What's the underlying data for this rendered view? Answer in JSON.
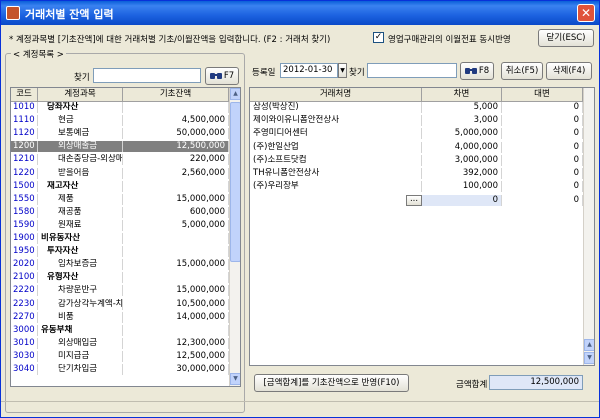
{
  "window": {
    "title": "거래처별 잔액 입력",
    "close": "✕"
  },
  "info": "* 계정과목별 [기초잔액]에 대한 거래처별 기초/이월잔액을 입력합니다. (F2 : 거래처 찾기)",
  "sync": {
    "label": "영업구매관리의 이월전표 동시반영",
    "checked": "✓"
  },
  "buttons": {
    "close": "닫기(ESC)",
    "find_left": "F7",
    "find_right": "F8",
    "cancel": "취소(F5)",
    "delete": "삭제(F4)",
    "apply": "[금액합계]를 기초잔액으로 반영(F10)"
  },
  "left": {
    "group_label": "< 계정목록 >",
    "find_label": "찾기",
    "find_value": "",
    "columns": [
      "코드",
      "계정과목",
      "기초잔액"
    ],
    "rows": [
      {
        "code": "1010",
        "name": "당좌자산",
        "amount": "",
        "type": "head"
      },
      {
        "code": "1110",
        "name": "현금",
        "amount": "4,500,000",
        "type": "item"
      },
      {
        "code": "1120",
        "name": "보통예금",
        "amount": "50,000,000",
        "type": "item"
      },
      {
        "code": "1200",
        "name": "외상매출금",
        "amount": "12,500,000",
        "type": "sel"
      },
      {
        "code": "1210",
        "name": "대손충당금-외상매출금",
        "amount": "220,000",
        "type": "item"
      },
      {
        "code": "1220",
        "name": "받을어음",
        "amount": "2,560,000",
        "type": "item"
      },
      {
        "code": "1500",
        "name": "재고자산",
        "amount": "",
        "type": "head"
      },
      {
        "code": "1550",
        "name": "제품",
        "amount": "15,000,000",
        "type": "item"
      },
      {
        "code": "1580",
        "name": "재공품",
        "amount": "600,000",
        "type": "item"
      },
      {
        "code": "1590",
        "name": "원재료",
        "amount": "5,000,000",
        "type": "item"
      },
      {
        "code": "1900",
        "name": "비유동자산",
        "amount": "",
        "type": "head0"
      },
      {
        "code": "1950",
        "name": "투자자산",
        "amount": "",
        "type": "head"
      },
      {
        "code": "2020",
        "name": "임차보증금",
        "amount": "15,000,000",
        "type": "item"
      },
      {
        "code": "2100",
        "name": "유형자산",
        "amount": "",
        "type": "head"
      },
      {
        "code": "2220",
        "name": "차량운반구",
        "amount": "15,000,000",
        "type": "item"
      },
      {
        "code": "2230",
        "name": "감가상각누계액-차량운반",
        "amount": "10,500,000",
        "type": "item"
      },
      {
        "code": "2270",
        "name": "비품",
        "amount": "14,000,000",
        "type": "item"
      },
      {
        "code": "3000",
        "name": "유동부채",
        "amount": "",
        "type": "head0"
      },
      {
        "code": "3010",
        "name": "외상매입금",
        "amount": "12,300,000",
        "type": "item"
      },
      {
        "code": "3030",
        "name": "미지급금",
        "amount": "12,500,000",
        "type": "item"
      },
      {
        "code": "3040",
        "name": "단기차입금",
        "amount": "30,000,000",
        "type": "item"
      }
    ]
  },
  "right": {
    "date_label": "등록일",
    "date_value": "2012-01-30",
    "find_label": "찾기",
    "find_value": "",
    "columns": [
      "거래처명",
      "차변",
      "대변"
    ],
    "rows": [
      {
        "name": "삼성(박상진)",
        "debit": "5,000",
        "credit": "0"
      },
      {
        "name": "제이와이유니폼안전상사",
        "debit": "3,000",
        "credit": "0"
      },
      {
        "name": "주영미디어센터",
        "debit": "5,000,000",
        "credit": "0"
      },
      {
        "name": "(주)한일산업",
        "debit": "4,000,000",
        "credit": "0"
      },
      {
        "name": "(주)소프트닷컴",
        "debit": "3,000,000",
        "credit": "0"
      },
      {
        "name": "TH유니폼안전상사",
        "debit": "392,000",
        "credit": "0"
      },
      {
        "name": "(주)우리장부",
        "debit": "100,000",
        "credit": "0"
      }
    ],
    "input_row": {
      "name": "",
      "lookup": "...",
      "debit": "0",
      "credit": "0"
    },
    "total_label": "금액합계",
    "total_value": "12,500,000"
  }
}
